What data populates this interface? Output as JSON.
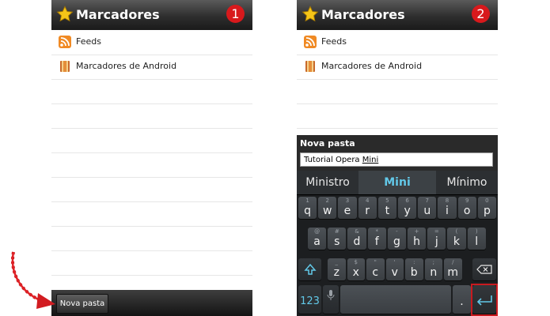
{
  "screens": [
    {
      "title": "Marcadores",
      "step": "1",
      "items": [
        {
          "icon": "rss-feed-icon",
          "label": "Feeds"
        },
        {
          "icon": "android-bookmarks-icon",
          "label": "Marcadores de Android"
        }
      ],
      "bottom_button": "Nova pasta"
    },
    {
      "title": "Marcadores",
      "step": "2",
      "items": [
        {
          "icon": "rss-feed-icon",
          "label": "Feeds"
        },
        {
          "icon": "android-bookmarks-icon",
          "label": "Marcadores de Android"
        }
      ],
      "dialog": {
        "title": "Nova pasta",
        "input_prefix": "Tutorial Opera ",
        "input_word": "Mini"
      },
      "keyboard": {
        "suggestions": [
          "Ministro",
          "Mini",
          "Mínimo"
        ],
        "row1": [
          {
            "hint": "1",
            "ch": "q"
          },
          {
            "hint": "2",
            "ch": "w"
          },
          {
            "hint": "3",
            "ch": "e"
          },
          {
            "hint": "4",
            "ch": "r"
          },
          {
            "hint": "5",
            "ch": "t"
          },
          {
            "hint": "6",
            "ch": "y"
          },
          {
            "hint": "7",
            "ch": "u"
          },
          {
            "hint": "8",
            "ch": "i"
          },
          {
            "hint": "9",
            "ch": "o"
          },
          {
            "hint": "0",
            "ch": "p"
          }
        ],
        "row2": [
          {
            "hint": "@",
            "ch": "a"
          },
          {
            "hint": "#",
            "ch": "s"
          },
          {
            "hint": "&",
            "ch": "d"
          },
          {
            "hint": "*",
            "ch": "f"
          },
          {
            "hint": "-",
            "ch": "g"
          },
          {
            "hint": "+",
            "ch": "h"
          },
          {
            "hint": "=",
            "ch": "j"
          },
          {
            "hint": "(",
            "ch": "k"
          },
          {
            "hint": ")",
            "ch": "l"
          }
        ],
        "row3": [
          {
            "hint": "_",
            "ch": "z"
          },
          {
            "hint": "$",
            "ch": "x"
          },
          {
            "hint": "\"",
            "ch": "c"
          },
          {
            "hint": "'",
            "ch": "v"
          },
          {
            "hint": ":",
            "ch": "b"
          },
          {
            "hint": ";",
            "ch": "n"
          },
          {
            "hint": "/",
            "ch": "m"
          }
        ],
        "sym_key": "123",
        "period_key": "."
      }
    }
  ],
  "colors": {
    "badge": "#d8191c",
    "suggestion_highlight": "#62c8e8",
    "annotation": "#c81a1f"
  }
}
